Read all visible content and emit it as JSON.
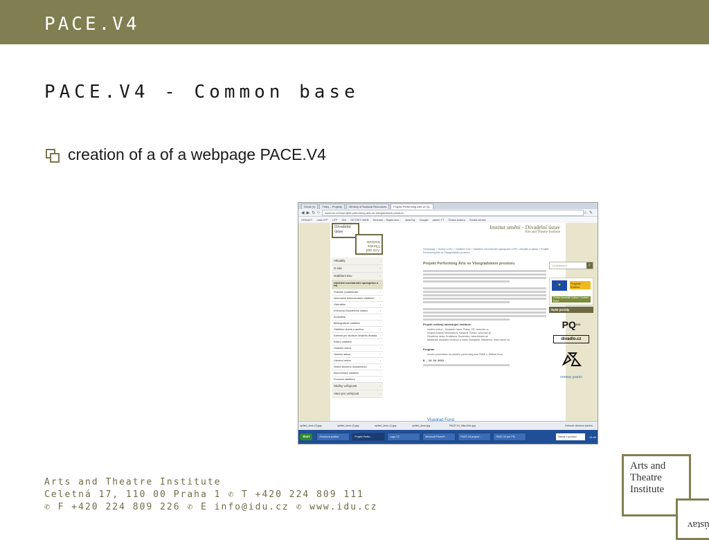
{
  "slide": {
    "title": "PACE.V4",
    "heading": "PACE.V4 - Common base",
    "bullet": "creation of a of a webpage PACE.V4"
  },
  "browser": {
    "tabs": [
      {
        "label": "Gmail (1)"
      },
      {
        "label": "Fotky – Projekty"
      },
      {
        "label": "Ministry of National Resources"
      },
      {
        "label": "Projekt Performing Arts ve Vy..."
      }
    ],
    "url": "www.idu.cz/cs/projekt-performing-arts-ve-visegradskem-prostoru",
    "bookmarks": [
      "ODKAZY",
      "mail UTF",
      "UTF",
      "IDU",
      "DETSKY WEB",
      "Seznam – Najdu tam...",
      "sklad ky",
      "Google",
      "admin TT",
      "Česká kultura",
      "Česká centra"
    ]
  },
  "site": {
    "title_line1": "Institut umění - Divadelní ústav",
    "title_line2": "Arts and Theatre Institute",
    "logo_cz": "Divadelní ústav",
    "logo_en": "Arts and Theatre Institute",
    "breadcrumb": "Homepage > Služby a IDU > Oddělení IDU > Oddělení mezinárodní spolupráce a PR > Aktuální projekty > Projekt Performing Arts ve Visegrádském prostoru",
    "nav": [
      {
        "label": "Aktuality",
        "top": true
      },
      {
        "label": "O nás",
        "top": true
      },
      {
        "label": "Oddělení IDU",
        "top": true
      },
      {
        "label": "Oddělení mezinárodní spolupráce a PR",
        "selected": true
      },
      {
        "label": "Pražské Quadrienále"
      },
      {
        "label": "Informační dokumentační oddělení"
      },
      {
        "label": "Videotéka"
      },
      {
        "label": "Knihovna Divadelního ústavu"
      },
      {
        "label": "Audiotéka"
      },
      {
        "label": "Bibliografické oddělení"
      },
      {
        "label": "Oddělení sbírek a archivu"
      },
      {
        "label": "Kabinet pro studium českého divadla"
      },
      {
        "label": "Ediční oddělení"
      },
      {
        "label": "Hudební sekce"
      },
      {
        "label": "Taneční sekce"
      },
      {
        "label": "Literární sekce"
      },
      {
        "label": "Sekce lidového divadelnictví"
      },
      {
        "label": "Ekonomické oddělení"
      },
      {
        "label": "Provozní oddělení"
      },
      {
        "label": "Služby veřejnosti",
        "top": true
      },
      {
        "label": "Akce pro veřejnost",
        "top": true
      }
    ],
    "content_title": "Projekt Performing Arts ve Visegrádském prostoru",
    "list_heading": "Projekt realizují následující instituce:",
    "list": [
      "Institut umění – Divadelní ústav, Praha, ČR, www.idu.cz",
      "Instytut Adama Mickiewicza, Varšava, Polsko, www.iam.pl",
      "Divadelný ústav, Bratislava, Slovensko, www.theatre.sk",
      "Maďarské divadelní muzeum a ústav, Budapešť, Maďarsko, www.oszmi.hu"
    ],
    "program_heading": "Program",
    "program_line": "úvodní prezentace na veletrhu performing arts FAME v Jihlavě/ Brno",
    "dates": "8. – 12. 10. 2012",
    "visegrad": "Visegrad Fund",
    "search_placeholder": "Vyhledávání",
    "promo_label": "Program Kultura",
    "promo_bar": "Česká kancelář Culture Contact Point",
    "portaly": "Naše portály",
    "pq": "PQ",
    "pq_year": "011",
    "divadlo": "divadlo.cz",
    "norway": "norway grants"
  },
  "downloads": {
    "items": [
      "vyhled_dovn (3).jpg",
      "vyhled_dovn (2).jpg",
      "vyhled_dovn (1).jpg",
      "vyhled_dovn.jpg",
      "PACE.V4_titka.A4m.jpg"
    ],
    "show_all": "Zobrazit všechna stažení..."
  },
  "taskbar": {
    "start": "Start",
    "tasks": [
      "Zvonkova políčka",
      "Projekt Perfor...",
      "Logo C2",
      "Microsoft PowerP...",
      "PACE.V4 project...",
      "PACE.V4 pre PR..."
    ],
    "search": "Hledat v počítači",
    "clock": "14:49"
  },
  "footer": {
    "line1": "Arts and Theatre Institute",
    "line2": "Celetná 17, 110 00 Praha 1 ✆ T +420 224 809 111",
    "line3": "✆ F +420 224 809 226 ✆ E info@idu.cz ✆ www.idu.cz"
  },
  "logo": {
    "text": "Arts and\nTheatre\nInstitute",
    "reversed": "ústav"
  },
  "colors": {
    "brand": "#817e52",
    "topbar": "#817e52",
    "site_accent": "#6c6a43"
  }
}
